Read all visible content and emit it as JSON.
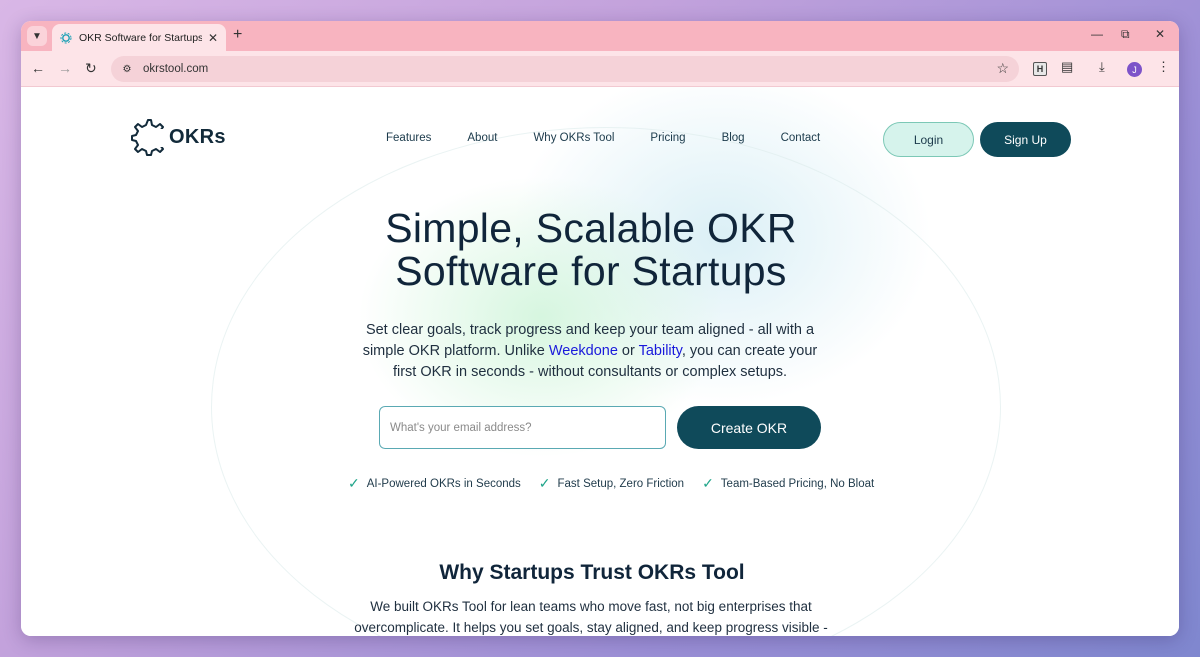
{
  "browser": {
    "tab_title": "OKR Software for Startups and",
    "url": "okrstool.com",
    "profile_initial": "J",
    "extension_letter": "H"
  },
  "site": {
    "logo_text": "OKRs",
    "nav": [
      "Features",
      "About",
      "Why OKRs Tool",
      "Pricing",
      "Blog",
      "Contact"
    ],
    "login_label": "Login",
    "signup_label": "Sign Up"
  },
  "hero": {
    "title_line1": "Simple, Scalable OKR",
    "title_line2": "Software for Startups",
    "sub_part1": "Set clear goals, track progress and keep your team aligned - all with a simple OKR platform. Unlike ",
    "link1": "Weekdone",
    "sub_part2": " or ",
    "link2": "Tability",
    "sub_part3": ", you can create your first OKR in seconds - without consultants or complex setups.",
    "email_placeholder": "What's your email address?",
    "cta_label": "Create OKR",
    "features": [
      "AI-Powered OKRs in Seconds",
      "Fast Setup, Zero Friction",
      "Team-Based Pricing, No Bloat"
    ]
  },
  "section": {
    "title": "Why Startups Trust OKRs Tool",
    "body": "We built OKRs Tool for lean teams who move fast, not big enterprises that overcomplicate. It helps you set goals, stay aligned, and keep progress visible - without"
  },
  "colors": {
    "accent": "#0f4a5a",
    "link": "#1a1adb",
    "check": "#20a58a",
    "tabstrip": "#f8b4c0"
  }
}
